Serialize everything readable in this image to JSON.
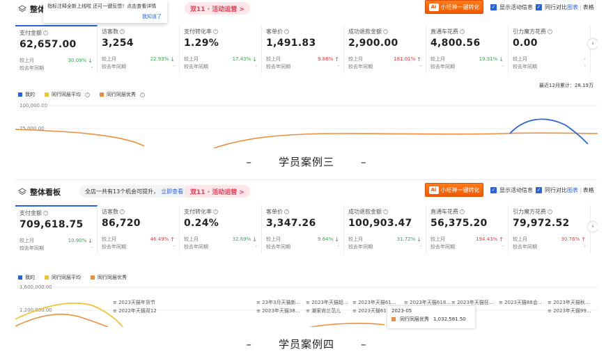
{
  "panels": [
    {
      "board_title": "整体",
      "tooltip": {
        "text": "指标注释全新上线啦 还可一键反馈！点击查看详情",
        "ok": "我知道了"
      },
      "activity": "双11 · 活动运营 >",
      "cta": {
        "logo": "Ai",
        "label": "小旺神一键转化"
      },
      "options": [
        "显示活动信息",
        "同行对比"
      ],
      "view_switch": {
        "chart": "图表",
        "table": "表格"
      },
      "metrics": [
        {
          "name": "支付金额",
          "value": "62,657.00",
          "cmp_label": "较上月",
          "chg": "30.09%",
          "dir": "down",
          "yoy_label": "较去年同期",
          "yoy": "-"
        },
        {
          "name": "访客数",
          "value": "3,254",
          "cmp_label": "较上月",
          "chg": "22.93%",
          "dir": "down",
          "yoy_label": "较去年同期",
          "yoy": "-"
        },
        {
          "name": "支付转化率",
          "value": "1.29%",
          "cmp_label": "较上月",
          "chg": "17.43%",
          "dir": "down",
          "yoy_label": "较去年同期",
          "yoy": "-"
        },
        {
          "name": "客单价",
          "value": "1,491.83",
          "cmp_label": "较上月",
          "chg": "9.86%",
          "dir": "up",
          "yoy_label": "较去年同期",
          "yoy": "-"
        },
        {
          "name": "成功退款金额",
          "value": "2,900.00",
          "cmp_label": "较上月",
          "chg": "181.01%",
          "dir": "up",
          "yoy_label": "较去年同期",
          "yoy": "-"
        },
        {
          "name": "直通车花费",
          "value": "4,800.56",
          "cmp_label": "较上月",
          "chg": "19.31%",
          "dir": "down",
          "yoy_label": "较去年同期",
          "yoy": "-"
        },
        {
          "name": "引力魔方花费",
          "value": "0.00",
          "cmp_label": "较上月",
          "chg": "-",
          "dir": "none",
          "yoy_label": "较去年同期",
          "yoy": "-"
        }
      ],
      "annual_total": "最近12月累计：28.19万",
      "legend": [
        "我的",
        "同行同层平均",
        "同行同层优秀"
      ],
      "y_ticks": [
        "100,000.00",
        "75,000.00"
      ],
      "caption": "学员案例三"
    },
    {
      "board_title": "整体看板",
      "chance": {
        "text": "全店一共有13个机会可提升，",
        "link": "立即查看 >"
      },
      "activity": "双11 · 活动运营 >",
      "cta": {
        "logo": "Ai",
        "label": "小旺神一键转化"
      },
      "options": [
        "显示活动信息",
        "同行对比"
      ],
      "view_switch": {
        "chart": "图表",
        "table": "表格"
      },
      "metrics": [
        {
          "name": "支付金额",
          "value": "709,618.75",
          "cmp_label": "较上月",
          "chg": "10.90%",
          "dir": "down",
          "yoy_label": "较去年同期",
          "yoy": "-"
        },
        {
          "name": "访客数",
          "value": "86,720",
          "cmp_label": "较上月",
          "chg": "46.49%",
          "dir": "up",
          "yoy_label": "较去年同期",
          "yoy": "-"
        },
        {
          "name": "支付转化率",
          "value": "0.24%",
          "cmp_label": "较上月",
          "chg": "32.69%",
          "dir": "down",
          "yoy_label": "较去年同期",
          "yoy": "-"
        },
        {
          "name": "客单价",
          "value": "3,347.26",
          "cmp_label": "较上月",
          "chg": "9.64%",
          "dir": "down",
          "yoy_label": "较去年同期",
          "yoy": "-"
        },
        {
          "name": "成功退款金额",
          "value": "100,903.47",
          "cmp_label": "较上月",
          "chg": "31.72%",
          "dir": "down",
          "yoy_label": "较去年同期",
          "yoy": "-"
        },
        {
          "name": "直通车花费",
          "value": "56,375.20",
          "cmp_label": "较上月",
          "chg": "194.43%",
          "dir": "up",
          "yoy_label": "较去年同期",
          "yoy": "-"
        },
        {
          "name": "引力魔方花费",
          "value": "79,972.52",
          "cmp_label": "较上月",
          "chg": "30.76%",
          "dir": "up",
          "yoy_label": "较去年同期",
          "yoy": "-"
        }
      ],
      "legend": [
        "我的",
        "同行同层平均",
        "同行同层优秀"
      ],
      "y_ticks": [
        "1,600,000.00",
        "1,200,000.00"
      ],
      "events": [
        "2023天猫年货节",
        "2022年天猫双12",
        "23年3月天猫新...",
        "2023年天猫38...",
        "2023年天猫超...",
        "潮家尚兰范儿",
        "2023年天猫61...",
        "2023天猫61",
        "2023年天猫618...",
        "2023年天猫狂...",
        "2023天猫88会...",
        "2023年天猫秋...",
        "2023年天猫99..."
      ],
      "hover_tip": {
        "date": "2023-05",
        "series": "同行同层优秀",
        "value": "1,032,581.50"
      },
      "caption": "学员案例四"
    }
  ],
  "colors": {
    "mine": "#2962d9",
    "avg": "#f2c438",
    "excellent": "#f08d3c",
    "up": "#e53e3e",
    "down": "#3aa655",
    "brand": "#f25a00"
  },
  "icons": {
    "board": "layers-icon",
    "next": "chevron-right-icon"
  }
}
